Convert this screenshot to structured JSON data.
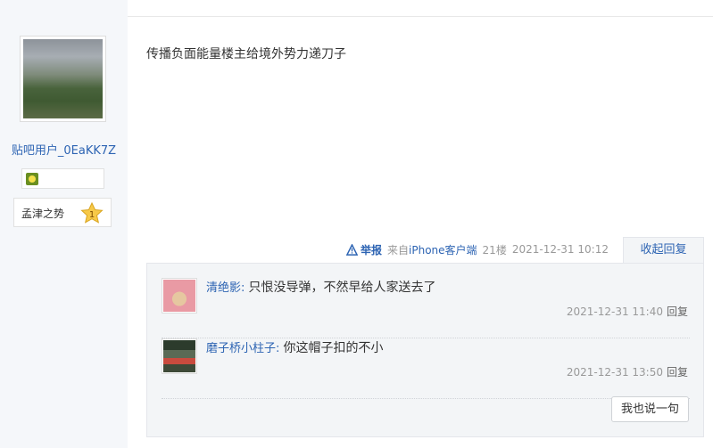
{
  "top_cut_text": "",
  "author": {
    "username": "贴吧用户_0EaKK7Z",
    "avatar_icon": "user-avatar-landscape",
    "badge_icon": "member-badge-icon",
    "level": {
      "name": "孟津之势",
      "number": "1"
    }
  },
  "post": {
    "content": "传播负面能量楼主给境外势力递刀子",
    "report_label": "举报",
    "via_prefix": "来自",
    "via_link": "iPhone客户端",
    "floor": "21楼",
    "timestamp": "2021-12-31 10:12",
    "collapse_label": "收起回复"
  },
  "replies": [
    {
      "author": "清绝影",
      "separator": ": ",
      "text": "只恨没导弹，不然早给人家送去了",
      "time": "2021-12-31 11:40",
      "reply_label": "回复"
    },
    {
      "author": "磨子桥小柱子",
      "separator": ": ",
      "text": "你这帽子扣的不小",
      "time": "2021-12-31 13:50",
      "reply_label": "回复"
    }
  ],
  "say_button": "我也说一句",
  "colors": {
    "link": "#2d64b3",
    "sidebar_bg": "#f5f7fa",
    "reply_bg": "#f3f5f7"
  }
}
